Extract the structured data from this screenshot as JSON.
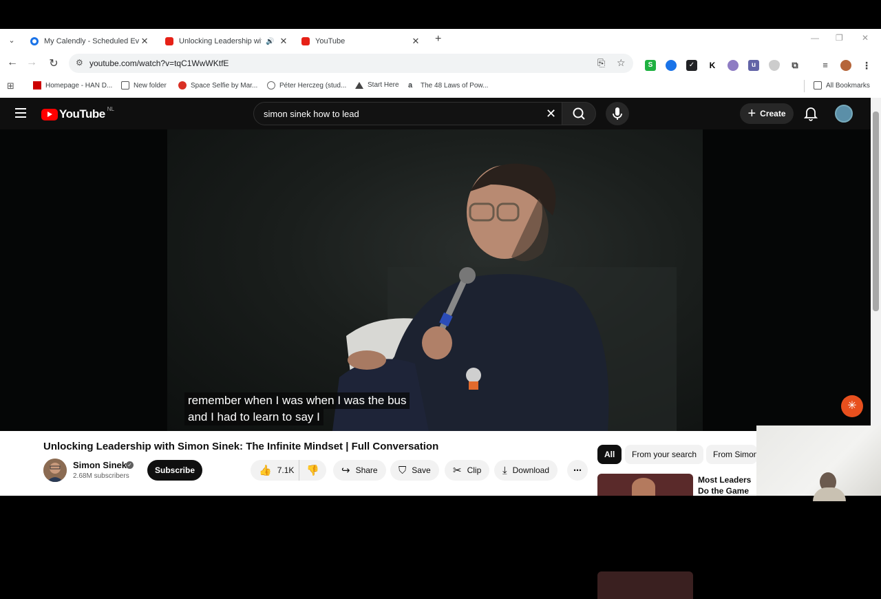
{
  "browser": {
    "tabs": [
      {
        "title": "My Calendly - Scheduled Events",
        "icon": "calendly-icon",
        "favicon_color": "#006bff"
      },
      {
        "title": "Unlocking Leadership with",
        "icon": "youtube-icon",
        "favicon_color": "#ff0000",
        "active": true,
        "audio": true
      },
      {
        "title": "YouTube",
        "icon": "youtube-icon",
        "favicon_color": "#ff0000"
      }
    ],
    "url": "youtube.com/watch?v=tqC1WwWKtfE",
    "bookmarks": [
      {
        "label": "Homepage - HAN D...",
        "icon": "han-icon"
      },
      {
        "label": "New folder",
        "icon": "folder-icon"
      },
      {
        "label": "Space Selfie by Mar...",
        "icon": "space-icon"
      },
      {
        "label": "Péter Herczeg (stud...",
        "icon": "globe-icon"
      },
      {
        "label": "Start Here",
        "icon": "triangle-icon"
      },
      {
        "label": "The 48 Laws of Pow...",
        "icon": "amazon-icon"
      }
    ],
    "all_bookmarks": "All Bookmarks",
    "extensions": [
      {
        "label": "S",
        "color": "#1fb141"
      },
      {
        "label": "",
        "color": "#1a73e8"
      },
      {
        "label": "✓",
        "color": "#202124"
      },
      {
        "label": "K",
        "color": "#ffffff"
      },
      {
        "label": "",
        "color": "#8e7cc3"
      },
      {
        "label": "u",
        "color": "#6264a7"
      }
    ]
  },
  "youtube": {
    "region": "NL",
    "search_query": "simon sinek how to lead",
    "create_label": "Create",
    "subtitles": [
      "remember when I was when I was the bus",
      "and I had to learn to say I"
    ],
    "video_title": "Unlocking Leadership with Simon Sinek: The Infinite Mindset | Full Conversation",
    "channel": {
      "name": "Simon Sinek",
      "subscribers": "2.68M subscribers"
    },
    "subscribe_label": "Subscribe",
    "likes": "7.1K",
    "actions": {
      "share": "Share",
      "save": "Save",
      "clip": "Clip",
      "download": "Download"
    },
    "chips": [
      "All",
      "From your search",
      "From Simon"
    ],
    "recommendation_title": "Most Leaders Do the Game They'r"
  }
}
